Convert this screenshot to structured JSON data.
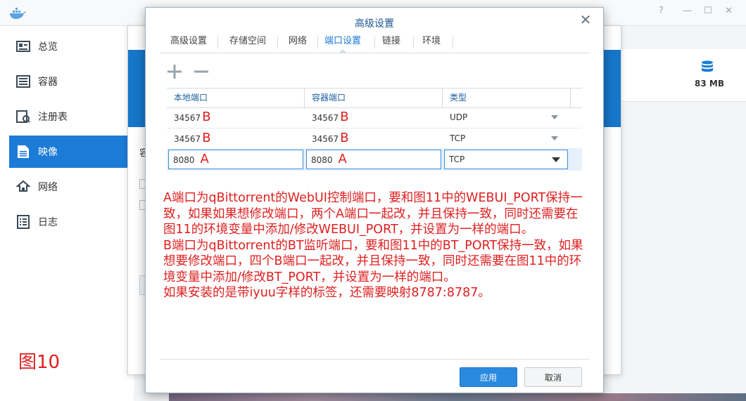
{
  "app": {
    "sidebar": [
      {
        "label": "总览",
        "icon": "overview-icon"
      },
      {
        "label": "容器",
        "icon": "container-icon"
      },
      {
        "label": "注册表",
        "icon": "registry-icon"
      },
      {
        "label": "映像",
        "icon": "image-icon",
        "active": true
      },
      {
        "label": "网络",
        "icon": "network-icon"
      },
      {
        "label": "日志",
        "icon": "log-icon"
      }
    ],
    "disk_size": "83 MB",
    "bg_label": "容"
  },
  "dialog": {
    "title": "高级设置",
    "tabs": [
      "高级设置",
      "存储空间",
      "网络",
      "端口设置",
      "链接",
      "环境"
    ],
    "active_tab": "端口设置",
    "columns": [
      "本地端口",
      "容器端口",
      "类型"
    ],
    "rows": [
      {
        "local": "34567",
        "local_mark": "B",
        "container": "34567",
        "container_mark": "B",
        "type": "UDP"
      },
      {
        "local": "34567",
        "local_mark": "B",
        "container": "34567",
        "container_mark": "B",
        "type": "TCP"
      }
    ],
    "edit_row": {
      "local": "8080",
      "local_mark": "A",
      "container": "8080",
      "container_mark": "A",
      "type": "TCP"
    },
    "note": [
      "A端口为qBittorrent的WebUI控制端口，要和图11中的WEBUI_PORT保持一致，如果如果想修改端口，两个A端口一起改，并且保持一致，同时还需要在图11的环境变量中添加/修改WEBUI_PORT，并设置为一样的端口。",
      "B端口为qBittorrent的BT监听端口，要和图11中的BT_PORT保持一致，如果想要修改端口，四个B端口一起改，并且保持一致，同时还需要在图11中的环境变量中添加/修改BT_PORT，并设置为一样的端口。",
      "如果安装的是带iyuu字样的标签，还需要映射8787:8787。"
    ],
    "apply_label": "应用",
    "cancel_label": "取消"
  },
  "figure_label": "图10"
}
